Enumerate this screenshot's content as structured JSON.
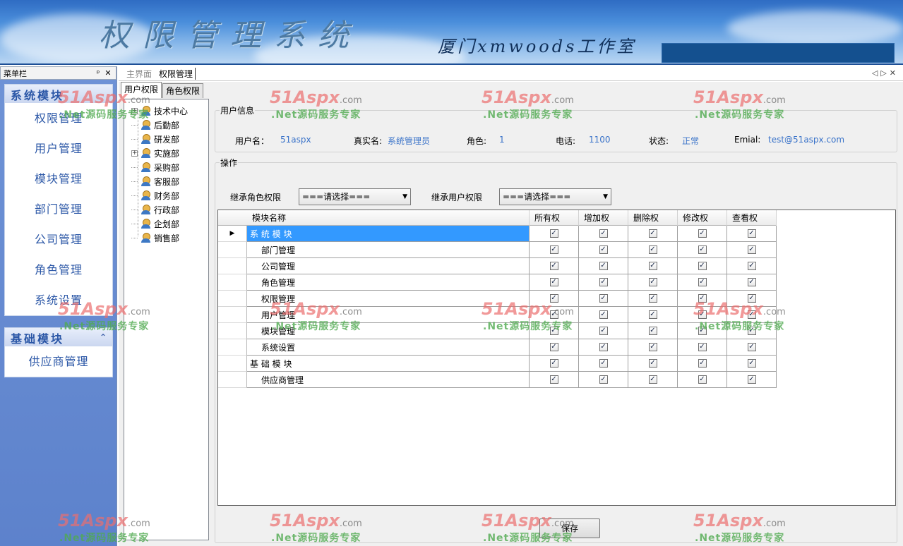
{
  "banner": {
    "title": "权限管理系统",
    "studio": "厦门xmwoods工作室"
  },
  "menu_panel": {
    "title": "菜单栏",
    "pin_icon": "pin-icon",
    "close_icon": "close-icon",
    "groups": [
      {
        "title": "系统模块",
        "items": [
          "权限管理",
          "用户管理",
          "模块管理",
          "部门管理",
          "公司管理",
          "角色管理",
          "系统设置"
        ]
      },
      {
        "title": "基础模块",
        "items": [
          "供应商管理"
        ]
      }
    ]
  },
  "doc_tabs": [
    {
      "label": "主界面",
      "active": false
    },
    {
      "label": "权限管理",
      "active": true
    }
  ],
  "sub_tabs": [
    {
      "label": "用户权限",
      "active": true
    },
    {
      "label": "角色权限",
      "active": false
    }
  ],
  "tree": [
    {
      "label": "技术中心",
      "expandable": true
    },
    {
      "label": "后勤部",
      "expandable": false
    },
    {
      "label": "研发部",
      "expandable": false
    },
    {
      "label": "实施部",
      "expandable": true
    },
    {
      "label": "采购部",
      "expandable": false
    },
    {
      "label": "客服部",
      "expandable": false
    },
    {
      "label": "财务部",
      "expandable": false
    },
    {
      "label": "行政部",
      "expandable": false
    },
    {
      "label": "企划部",
      "expandable": false
    },
    {
      "label": "销售部",
      "expandable": false
    }
  ],
  "user_info": {
    "legend": "用户信息",
    "username_label": "用户名：",
    "username": "51aspx",
    "realname_label": "真实名:",
    "realname": "系统管理员",
    "role_label": "角色:",
    "role": "1",
    "phone_label": "电话:",
    "phone": "1100",
    "status_label": "状态:",
    "status": "正常",
    "email_label": "Emial:",
    "email": "test@51aspx.com"
  },
  "operations": {
    "legend": "操作",
    "inherit_role_label": "继承角色权限",
    "inherit_role_value": "===请选择===",
    "inherit_user_label": "继承用户权限",
    "inherit_user_value": "===请选择===",
    "save_label": "保存"
  },
  "grid": {
    "columns": [
      "模块名称",
      "所有权",
      "增加权",
      "删除权",
      "修改权",
      "查看权"
    ],
    "rows": [
      {
        "name": "系 统 模 块",
        "level": 0,
        "selected": true,
        "perms": [
          true,
          true,
          true,
          true,
          true
        ]
      },
      {
        "name": "部门管理",
        "level": 1,
        "perms": [
          true,
          true,
          true,
          true,
          true
        ]
      },
      {
        "name": "公司管理",
        "level": 1,
        "perms": [
          true,
          true,
          true,
          true,
          true
        ]
      },
      {
        "name": "角色管理",
        "level": 1,
        "perms": [
          true,
          true,
          true,
          true,
          true
        ]
      },
      {
        "name": "权限管理",
        "level": 1,
        "perms": [
          true,
          true,
          true,
          true,
          true
        ]
      },
      {
        "name": "用户管理",
        "level": 1,
        "perms": [
          true,
          true,
          true,
          true,
          true
        ]
      },
      {
        "name": "模块管理",
        "level": 1,
        "perms": [
          true,
          true,
          true,
          true,
          true
        ]
      },
      {
        "name": "系统设置",
        "level": 1,
        "perms": [
          true,
          true,
          true,
          true,
          true
        ]
      },
      {
        "name": "基 础 模 块",
        "level": 0,
        "perms": [
          true,
          true,
          true,
          true,
          true
        ]
      },
      {
        "name": "供应商管理",
        "level": 1,
        "perms": [
          true,
          true,
          true,
          true,
          true
        ]
      }
    ]
  },
  "watermark": {
    "logo_main": "51Aspx",
    "logo_suffix": ".com",
    "slogan": ".Net源码服务专家"
  }
}
